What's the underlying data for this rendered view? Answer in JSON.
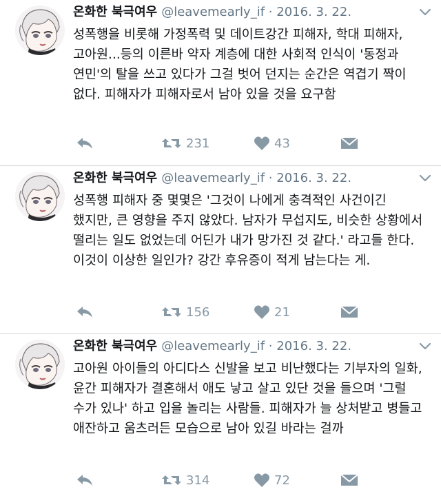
{
  "tweets": [
    {
      "author": {
        "display_name": "온화한 북극여우",
        "handle": "@leavemearly_if"
      },
      "separator": "·",
      "date": "2016. 3. 22.",
      "text": "성폭행을 비롯해 가정폭력 및 데이트강간 피해자, 학대 피해자, 고아원...등의 이른바 약자 계층에 대한 사회적 인식이 '동정과 연민'의 탈을 쓰고 있다가 그걸 벗어 던지는 순간은 역겹기 짝이 없다. 피해자가 피해자로서 남아 있을 것을 요구함",
      "retweets": "231",
      "likes": "43"
    },
    {
      "author": {
        "display_name": "온화한 북극여우",
        "handle": "@leavemearly_if"
      },
      "separator": "·",
      "date": "2016. 3. 22.",
      "text": "성폭행 피해자 중 몇몇은 '그것이 나에게 충격적인 사건이긴 했지만, 큰 영향을 주지 않았다. 남자가 무섭지도, 비슷한 상황에서 떨리는 일도 없었는데 어딘가 내가 망가진 것 같다.' 라고들 한다. 이것이 이상한 일인가? 강간 후유증이 적게 남는다는 게.",
      "retweets": "156",
      "likes": "21"
    },
    {
      "author": {
        "display_name": "온화한 북극여우",
        "handle": "@leavemearly_if"
      },
      "separator": "·",
      "date": "2016. 3. 22.",
      "text": "고아원 아이들의 아디다스 신발을 보고 비난했다는 기부자의 일화, 윤간 피해자가 결혼해서 애도 낳고 살고 있단 것을 들으며 '그럴 수가 있나' 하고 입을 놀리는 사람들. 피해자가 늘 상처받고 병들고 애잔하고 움츠러든 모습으로 남아 있길 바라는 걸까",
      "retweets": "314",
      "likes": "72"
    }
  ],
  "icons": {
    "reply": "reply-icon",
    "retweet": "retweet-icon",
    "like": "heart-icon",
    "message": "envelope-icon",
    "more": "chevron-down-icon",
    "avatar": "avatar-anime-character"
  },
  "colors": {
    "action_icon": "#8899a6",
    "handle": "#657786",
    "text": "#14171a",
    "divider": "#d6dadd"
  }
}
